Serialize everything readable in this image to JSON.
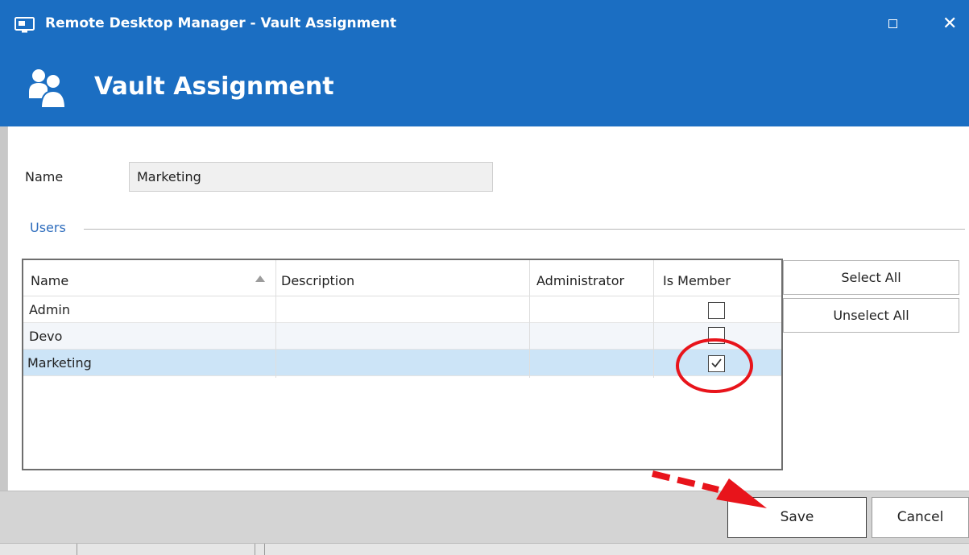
{
  "window": {
    "title": "Remote Desktop Manager - Vault Assignment",
    "app_icon": "remote-desktop-icon",
    "maximize_icon": "maximize-icon",
    "close_icon": "close-icon",
    "close_glyph": "✕"
  },
  "banner": {
    "icon": "users-group-icon",
    "heading": "Vault Assignment"
  },
  "form": {
    "name_label": "Name",
    "name_value": "Marketing"
  },
  "users": {
    "section_label": "Users",
    "columns": [
      "Name",
      "Description",
      "Administrator",
      "Is Member"
    ],
    "sort_column": "Name",
    "sort_direction": "ascending",
    "rows": [
      {
        "name": "Admin",
        "description": "",
        "administrator": "",
        "is_member": false
      },
      {
        "name": "Devo",
        "description": "",
        "administrator": "",
        "is_member": false
      },
      {
        "name": "Marketing",
        "description": "",
        "administrator": "",
        "is_member": true
      }
    ],
    "selected_row": "Marketing",
    "select_all_label": "Select All",
    "unselect_all_label": "Unselect All"
  },
  "footer": {
    "save_label": "Save",
    "cancel_label": "Cancel"
  },
  "annotations": {
    "highlight_icon": "red-circle-annotation",
    "arrow_icon": "red-arrow-annotation",
    "color": "#e8141b"
  },
  "colors": {
    "header_blue": "#1b6ec2",
    "section_label_blue": "#2e6dbd",
    "selected_row": "#cce4f7"
  }
}
